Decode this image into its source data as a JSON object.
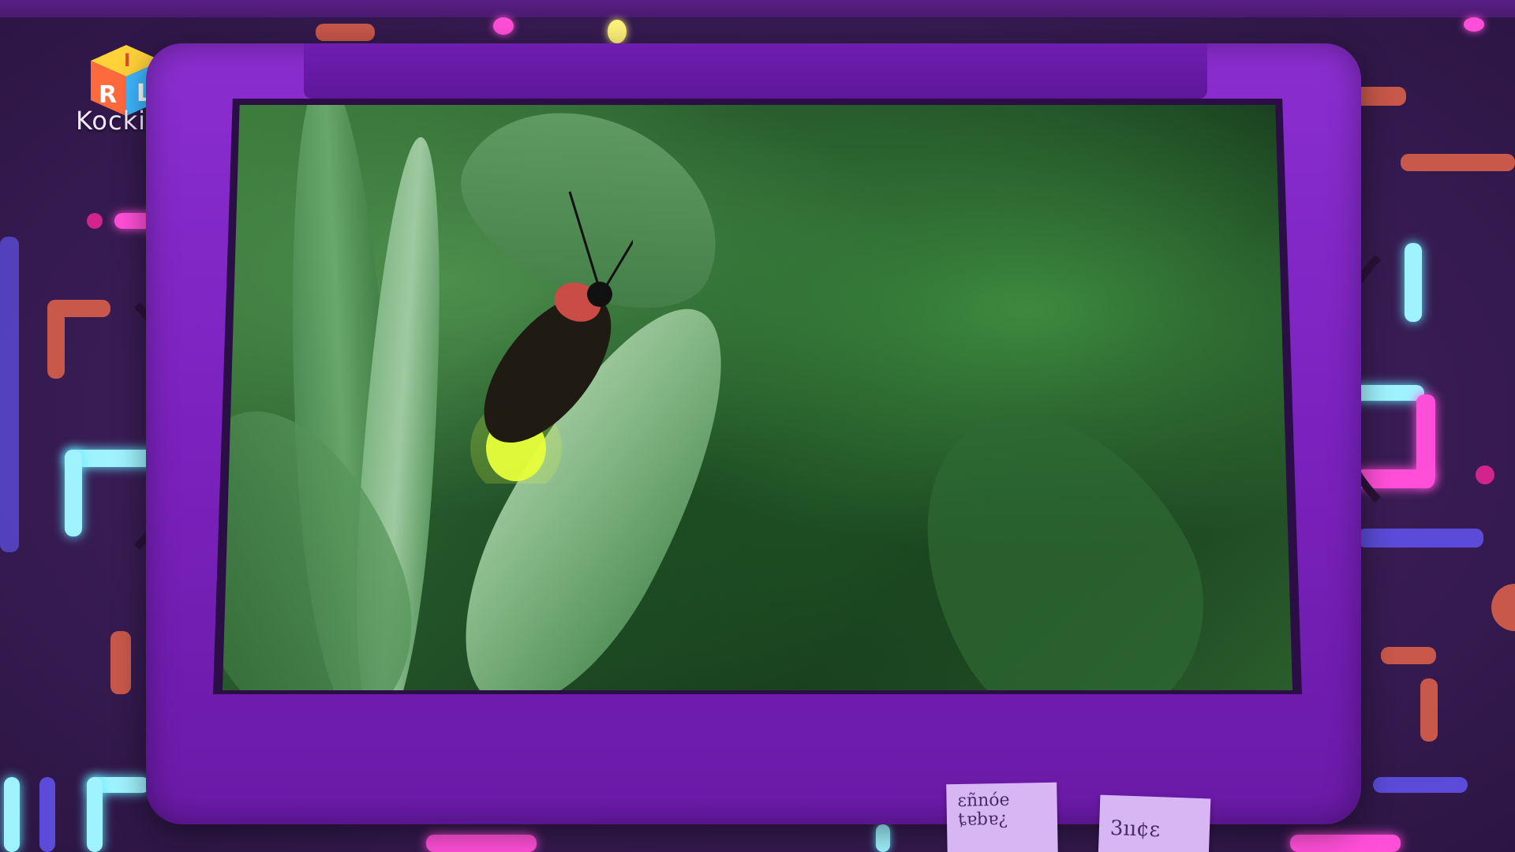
{
  "brand": {
    "name": "Kockica",
    "cube_letters": [
      "I",
      "R",
      "L"
    ]
  },
  "video": {
    "subject": "firefly on leaf"
  },
  "notes": [
    {
      "text_line1": "ɛñnóe",
      "text_line2": "ȶɐbɐ¿"
    },
    {
      "text_line1": "3ıı¢ɛ"
    }
  ],
  "colors": {
    "monitor": "#7a22be",
    "background": "#3d1f57",
    "neon_cyan": "#9ff3ff",
    "neon_pink": "#ff4fd8",
    "orange": "#e86a46",
    "blue": "#5b4bd8",
    "firefly_glow": "#e8ff3a"
  }
}
